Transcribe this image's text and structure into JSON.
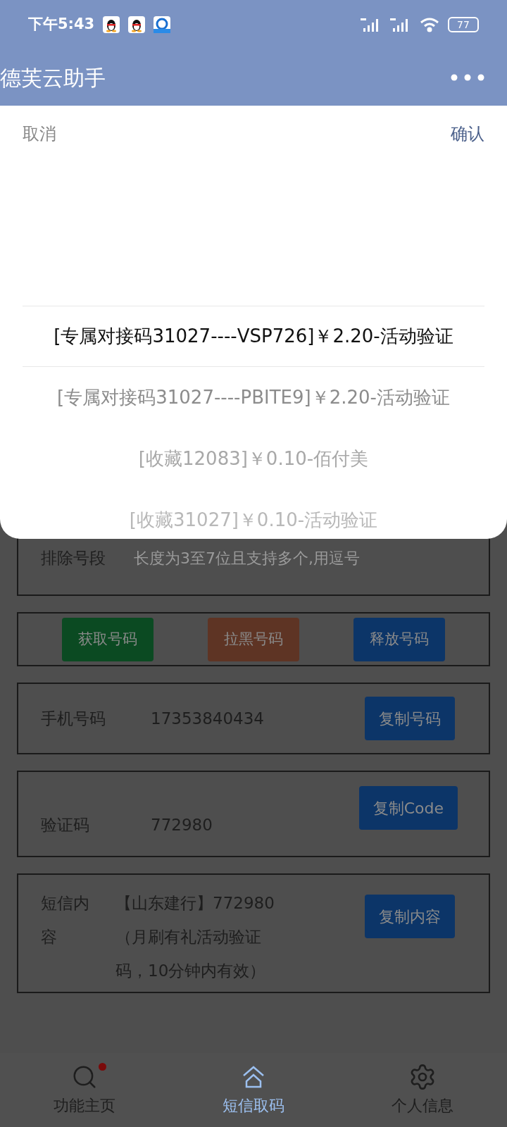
{
  "status_bar": {
    "time": "下午5:43",
    "battery": "77"
  },
  "header": {
    "title": "德芙云助手"
  },
  "picker": {
    "cancel": "取消",
    "confirm": "确认",
    "options": [
      {
        "label": "[专属对接码31027----VSP726]￥2.20-活动验证",
        "selected": true
      },
      {
        "label": "[专属对接码31027----PBITE9]￥2.20-活动验证",
        "selected": false
      },
      {
        "label": "[收藏12083]￥0.10-佰付美",
        "selected": false
      },
      {
        "label": "[收藏31027]￥0.10-活动验证",
        "selected": false
      }
    ]
  },
  "exclude": {
    "label": "排除号段",
    "placeholder": "长度为3至7位且支持多个,用逗号"
  },
  "actions": [
    {
      "label": "获取号码",
      "kind": "get"
    },
    {
      "label": "拉黑号码",
      "kind": "block"
    },
    {
      "label": "释放号码",
      "kind": "release"
    }
  ],
  "phone": {
    "label": "手机号码",
    "value": "17353840434",
    "button": "复制号码"
  },
  "code": {
    "label": "验证码",
    "value": "772980",
    "button": "复制Code"
  },
  "sms": {
    "label": "短信内容",
    "value": "【山东建行】772980（月刷有礼活动验证码，10分钟内有效）",
    "button": "复制内容"
  },
  "nav": [
    {
      "label": "功能主页",
      "badge": true,
      "selected": false
    },
    {
      "label": "短信取码",
      "badge": false,
      "selected": true
    },
    {
      "label": "个人信息",
      "badge": false,
      "selected": false
    }
  ]
}
